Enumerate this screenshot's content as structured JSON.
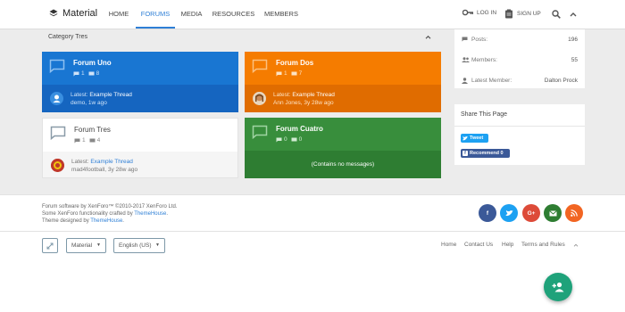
{
  "header": {
    "logo_text": "Material",
    "nav": [
      {
        "label": "HOME",
        "active": false
      },
      {
        "label": "FORUMS",
        "active": true
      },
      {
        "label": "MEDIA",
        "active": false
      },
      {
        "label": "RESOURCES",
        "active": false
      },
      {
        "label": "MEMBERS",
        "active": false
      }
    ],
    "login_label": "LOG IN",
    "signup_label": "SIGN UP"
  },
  "category": {
    "title": "Category Tres",
    "forums": [
      {
        "name": "Forum Uno",
        "threads": "1",
        "messages": "8",
        "latest_prefix": "Latest:",
        "latest_thread": "Example Thread",
        "meta": "demo, 1w ago",
        "color": "#1976d2",
        "bottom_color": "#1565c0"
      },
      {
        "name": "Forum Dos",
        "threads": "1",
        "messages": "7",
        "latest_prefix": "Latest:",
        "latest_thread": "Example Thread",
        "meta": "Ann Jones, 3y 28w ago",
        "color": "#f57c00",
        "bottom_color": "#e06c00"
      },
      {
        "name": "Forum Tres",
        "threads": "1",
        "messages": "4",
        "latest_prefix": "Latest:",
        "latest_thread": "Example Thread",
        "meta": "mad4football, 3y 28w ago",
        "color": "#ffffff",
        "bottom_color": "#f5f5f5"
      },
      {
        "name": "Forum Cuatro",
        "threads": "0",
        "messages": "0",
        "empty_text": "(Contains no messages)",
        "color": "#388e3c",
        "bottom_color": "#2e7d32"
      }
    ]
  },
  "stats": {
    "posts_label": "Posts:",
    "posts_value": "196",
    "members_label": "Members:",
    "members_value": "55",
    "latest_member_label": "Latest Member:",
    "latest_member_value": "Dalton Prock"
  },
  "share": {
    "title": "Share This Page",
    "tweet_label": "Tweet",
    "recommend_label": "Recommend 0"
  },
  "footer": {
    "line1": "Forum software by XenForo™ ©2010-2017 XenForo Ltd.",
    "line2_prefix": "Some XenForo functionality crafted by",
    "line2_link": "ThemeHouse",
    "line3_prefix": "Theme designed by",
    "line3_link": "ThemeHouse",
    "style_select": "Material",
    "language_select": "English (US)",
    "links": [
      "Home",
      "Contact Us",
      "Help",
      "Terms and Rules"
    ],
    "social_colors": {
      "facebook": "#3b5998",
      "twitter": "#1da1f2",
      "google": "#dd4b39",
      "email": "#2e7d32",
      "rss": "#f26522"
    }
  }
}
